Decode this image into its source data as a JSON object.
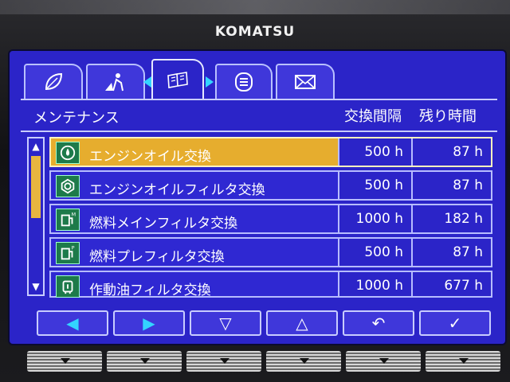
{
  "brand": "KOMATSU",
  "tabs": [
    {
      "icon": "leaf-icon",
      "active": false
    },
    {
      "icon": "worker-icon",
      "active": false
    },
    {
      "icon": "book-icon",
      "active": true
    },
    {
      "icon": "list-icon",
      "active": false
    },
    {
      "icon": "mail-icon",
      "active": false
    }
  ],
  "header": {
    "title": "メンテナンス",
    "col_interval": "交換間隔",
    "col_remaining": "残り時間"
  },
  "rows": [
    {
      "label": "エンジンオイル交換",
      "interval": "500 h",
      "remaining": "87 h",
      "selected": true,
      "icon": "oil-drop-icon"
    },
    {
      "label": "エンジンオイルフィルタ交換",
      "interval": "500 h",
      "remaining": "87 h",
      "selected": false,
      "icon": "oil-filter-icon"
    },
    {
      "label": "燃料メインフィルタ交換",
      "interval": "1000 h",
      "remaining": "182 h",
      "selected": false,
      "icon": "fuel-main-filter-icon",
      "badge": "M"
    },
    {
      "label": "燃料プレフィルタ交換",
      "interval": "500 h",
      "remaining": "87 h",
      "selected": false,
      "icon": "fuel-pre-filter-icon",
      "badge": "P"
    },
    {
      "label": "作動油フィルタ交換",
      "interval": "1000 h",
      "remaining": "677 h",
      "selected": false,
      "icon": "hydraulic-filter-icon"
    }
  ],
  "fkeys": [
    {
      "name": "left",
      "glyph": "◀"
    },
    {
      "name": "right",
      "glyph": "▶"
    },
    {
      "name": "down",
      "glyph": "▽"
    },
    {
      "name": "up",
      "glyph": "△"
    },
    {
      "name": "back",
      "glyph": "↶"
    },
    {
      "name": "confirm",
      "glyph": "✓"
    }
  ],
  "colors": {
    "screen_bg": "#2b24c8",
    "selected_row": "#e6ad2e",
    "icon_bg": "#1d7a4a",
    "nav_arrow": "#33d4ff"
  }
}
